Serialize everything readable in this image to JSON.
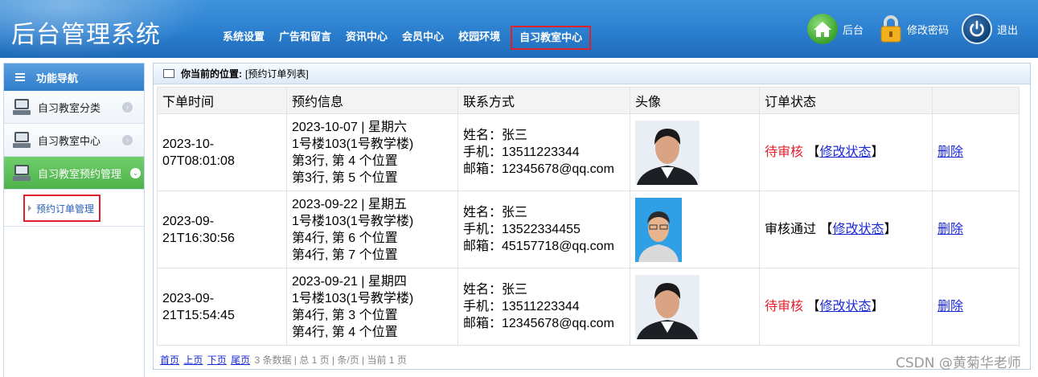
{
  "header": {
    "title": "后台管理系统",
    "nav": [
      "系统设置",
      "广告和留言",
      "资讯中心",
      "会员中心",
      "校园环境",
      "自习教室中心"
    ],
    "active_nav": "自习教室中心",
    "home_label": "后台",
    "password_label": "修改密码",
    "exit_label": "退出"
  },
  "sidebar": {
    "title": "功能导航",
    "items": [
      {
        "label": "自习教室分类"
      },
      {
        "label": "自习教室中心"
      },
      {
        "label": "自习教室预约管理"
      }
    ],
    "sub_item": "预约订单管理"
  },
  "main": {
    "crumb_label": "你当前的位置:",
    "crumb_value": "[预约订单列表]",
    "columns": [
      "下单时间",
      "预约信息",
      "联系方式",
      "头像",
      "订单状态",
      ""
    ],
    "rows": [
      {
        "time": "2023-10-07T08:01:08",
        "info": [
          "2023-10-07 | 星期六",
          "1号楼103(1号教学楼)",
          "第3行, 第 4 个位置",
          "第3行, 第 5 个位置"
        ],
        "contact": [
          "姓名：张三",
          "手机：13511223344",
          "邮箱：12345678@qq.com"
        ],
        "avatar": "photo-a",
        "status": "待审核",
        "status_kind": "pending",
        "modify": "修改状态",
        "delete": "删除"
      },
      {
        "time": "2023-09-21T16:30:56",
        "info": [
          "2023-09-22 | 星期五",
          "1号楼103(1号教学楼)",
          "第4行, 第 6 个位置",
          "第4行, 第 7 个位置"
        ],
        "contact": [
          "姓名：张三",
          "手机：13522334455",
          "邮箱：45157718@qq.com"
        ],
        "avatar": "photo-b",
        "status": "审核通过",
        "status_kind": "ok",
        "modify": "修改状态",
        "delete": "删除"
      },
      {
        "time": "2023-09-21T15:54:45",
        "info": [
          "2023-09-21 | 星期四",
          "1号楼103(1号教学楼)",
          "第4行, 第 3 个位置",
          "第4行, 第 4 个位置"
        ],
        "contact": [
          "姓名：张三",
          "手机：13511223344",
          "邮箱：12345678@qq.com"
        ],
        "avatar": "photo-a",
        "status": "待审核",
        "status_kind": "pending",
        "modify": "修改状态",
        "delete": "删除"
      }
    ],
    "pager": {
      "links": [
        "首页",
        "上页",
        "下页",
        "尾页"
      ],
      "summary": "3 条数据 | 总 1 页 | 条/页 | 当前 1 页"
    }
  },
  "watermark": "CSDN @黄菊华老师",
  "colors": {
    "header_blue": "#2b7fcf",
    "active_green": "#4fb24b",
    "pending_red": "#e0202a",
    "link_blue": "#1a29d8"
  }
}
